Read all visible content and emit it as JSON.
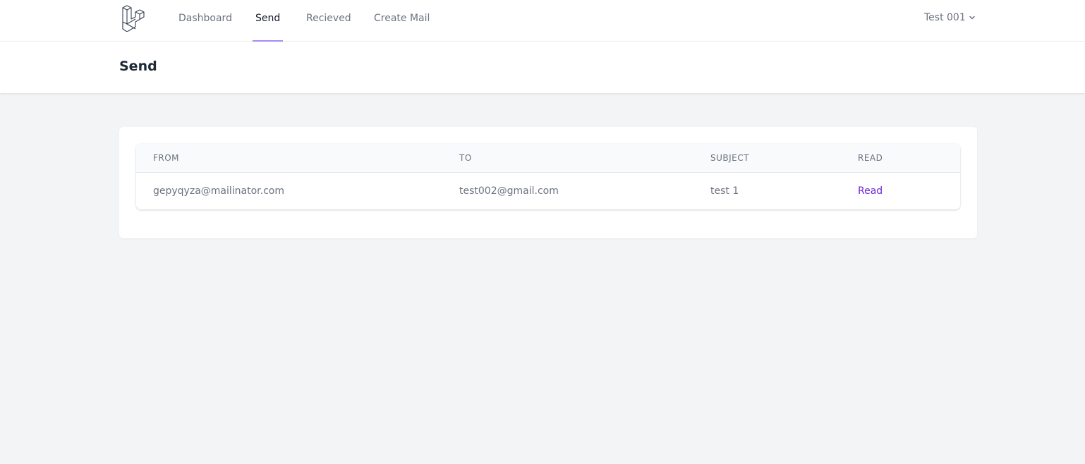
{
  "nav": {
    "links": [
      {
        "label": "Dashboard"
      },
      {
        "label": "Send"
      },
      {
        "label": "Recieved"
      },
      {
        "label": "Create Mail"
      }
    ],
    "user_name": "Test 001"
  },
  "header": {
    "title": "Send"
  },
  "table": {
    "columns": [
      "FROM",
      "TO",
      "SUBJECT",
      "READ"
    ],
    "rows": [
      {
        "from": "gepyqyza@mailinator.com",
        "to": "test002@gmail.com",
        "subject": "test 1",
        "read": "Read"
      }
    ]
  },
  "colors": {
    "accent": "#a78bfa",
    "link": "#6d28d9"
  }
}
